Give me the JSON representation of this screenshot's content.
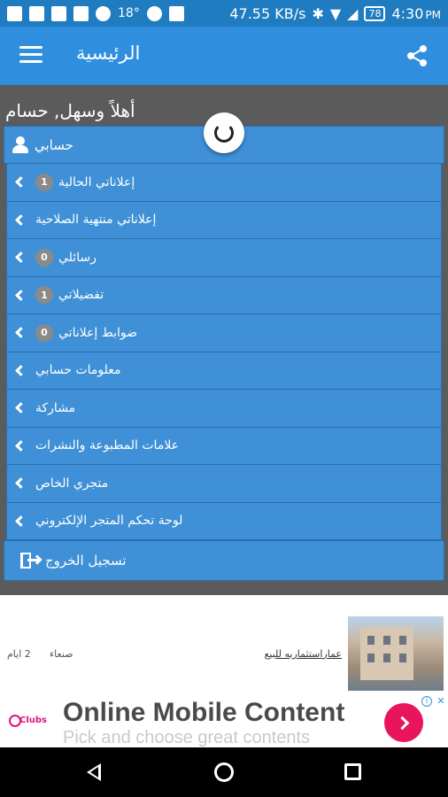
{
  "status_bar": {
    "temperature": "18°",
    "network_speed": "47.55 KB/s",
    "battery": "78",
    "time": "4:30",
    "time_suffix": "PM"
  },
  "app_bar": {
    "title": "الرئيسية"
  },
  "greeting": "أهلاً وسهل, حسام",
  "account": {
    "label": "حسابي"
  },
  "menu_items": [
    {
      "label": "إعلاناتي الحالية",
      "badge": "1"
    },
    {
      "label": "إعلاناتي منتهية الصلاحية",
      "badge": ""
    },
    {
      "label": "رسائلي",
      "badge": "0"
    },
    {
      "label": "تفضيلاتي",
      "badge": "1"
    },
    {
      "label": "ضوابط إعلاناتي",
      "badge": "0"
    },
    {
      "label": "معلومات حسابي",
      "badge": ""
    },
    {
      "label": "مشاركة",
      "badge": ""
    },
    {
      "label": "علامات المطبوعة والنشرات",
      "badge": ""
    },
    {
      "label": "متجري الخاص",
      "badge": ""
    },
    {
      "label": "لوحة تحكم المتجر الإلكتروني",
      "badge": ""
    }
  ],
  "logout": {
    "label": "تسجيل الخروج"
  },
  "listing": {
    "title": "عماراستثماريه للبيع",
    "city": "صنعاء",
    "age": "2 ايام"
  },
  "ad": {
    "logo_text": "Clubs",
    "title": "Online Mobile Content",
    "subtitle": "Pick and choose great contents"
  }
}
